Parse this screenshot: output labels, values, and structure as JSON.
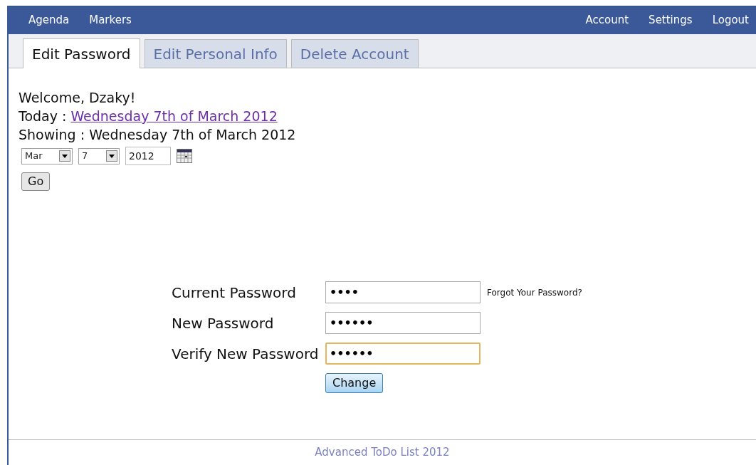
{
  "nav": {
    "left": [
      "Agenda",
      "Markers"
    ],
    "right": [
      "Account",
      "Settings",
      "Logout"
    ]
  },
  "tabs": [
    {
      "label": "Edit Password",
      "selected": true
    },
    {
      "label": "Edit Personal Info",
      "selected": false
    },
    {
      "label": "Delete Account",
      "selected": false
    }
  ],
  "welcome": "Welcome, Dzaky!",
  "today": {
    "label": "Today :",
    "link": "Wednesday 7th of March 2012"
  },
  "showing": "Showing : Wednesday 7th of March 2012",
  "date_picker": {
    "month": "Mar",
    "day": "7",
    "year": "2012",
    "go": "Go"
  },
  "form": {
    "fields": [
      {
        "label": "Current Password",
        "value": "••••",
        "focused": false,
        "link": "Forgot Your Password?"
      },
      {
        "label": "New Password",
        "value": "••••••",
        "focused": false
      },
      {
        "label": "Verify New Password",
        "value": "••••••",
        "focused": true
      }
    ],
    "submit": "Change"
  },
  "footer": "Advanced ToDo List 2012"
}
